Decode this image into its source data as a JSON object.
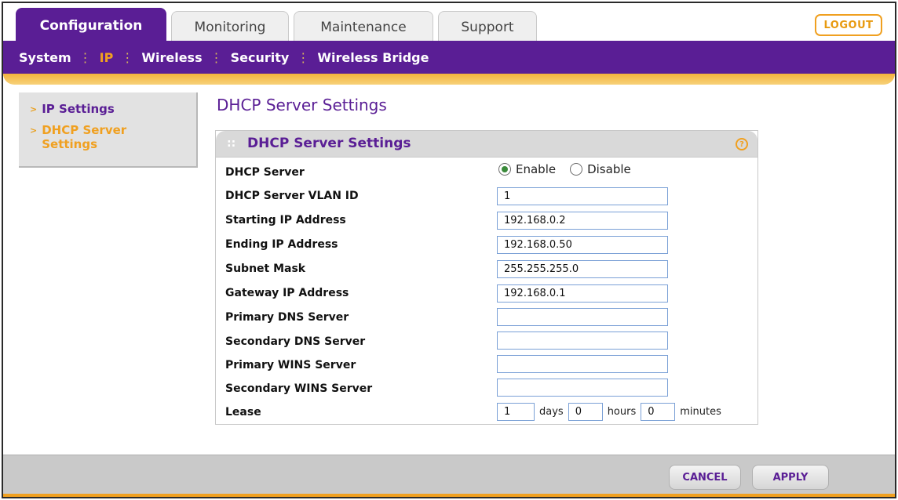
{
  "tabs": [
    {
      "label": "Configuration",
      "active": true
    },
    {
      "label": "Monitoring",
      "active": false
    },
    {
      "label": "Maintenance",
      "active": false
    },
    {
      "label": "Support",
      "active": false
    }
  ],
  "logout_label": "LOGOUT",
  "subnav": [
    {
      "label": "System",
      "active": false
    },
    {
      "label": "IP",
      "active": true
    },
    {
      "label": "Wireless",
      "active": false
    },
    {
      "label": "Security",
      "active": false
    },
    {
      "label": "Wireless Bridge",
      "active": false
    }
  ],
  "sidebar": {
    "items": [
      {
        "label": "IP Settings"
      },
      {
        "label": "DHCP Server Settings"
      }
    ]
  },
  "page_title": "DHCP Server Settings",
  "panel": {
    "title": "DHCP Server Settings",
    "help_icon": "?",
    "dhcp_server": {
      "label": "DHCP Server",
      "options": [
        "Enable",
        "Disable"
      ],
      "selected": "Enable"
    },
    "fields": [
      {
        "label": "DHCP Server VLAN ID",
        "value": "1"
      },
      {
        "label": "Starting IP Address",
        "value": "192.168.0.2"
      },
      {
        "label": "Ending IP Address",
        "value": "192.168.0.50"
      },
      {
        "label": "Subnet Mask",
        "value": "255.255.255.0"
      },
      {
        "label": "Gateway IP Address",
        "value": "192.168.0.1"
      },
      {
        "label": "Primary DNS Server",
        "value": ""
      },
      {
        "label": "Secondary DNS Server",
        "value": ""
      },
      {
        "label": "Primary WINS Server",
        "value": ""
      },
      {
        "label": "Secondary WINS Server",
        "value": ""
      }
    ],
    "lease": {
      "label": "Lease",
      "days": "1",
      "days_unit": "days",
      "hours": "0",
      "hours_unit": "hours",
      "minutes": "0",
      "minutes_unit": "minutes"
    }
  },
  "buttons": {
    "cancel": "CANCEL",
    "apply": "APPLY"
  },
  "colors": {
    "brand_purple": "#5a1e95",
    "accent_orange": "#f0a020"
  }
}
